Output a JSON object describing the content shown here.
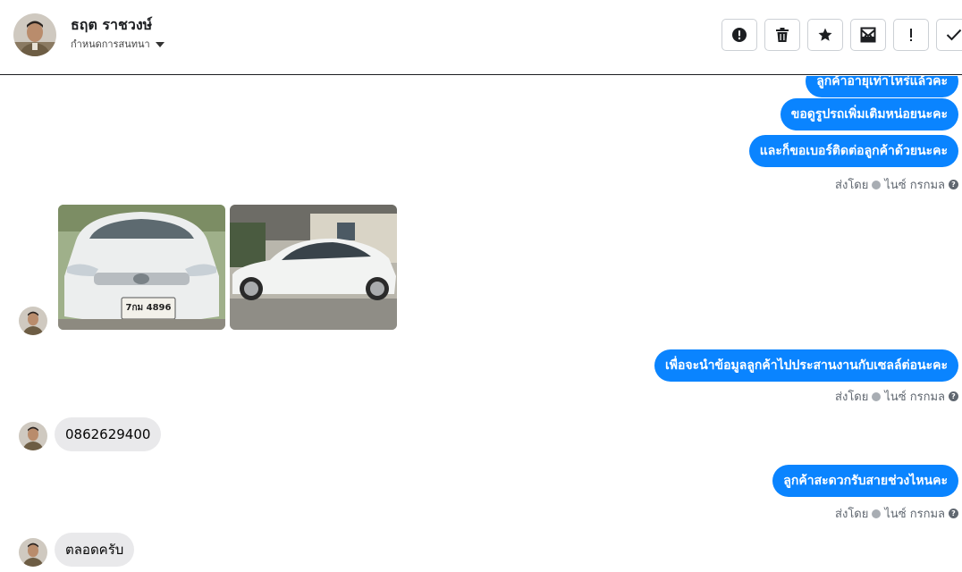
{
  "header": {
    "name": "ธฤต ราชวงษ์",
    "subtitle": "กำหนดการสนทนา"
  },
  "toolbar": {
    "buttons": [
      {
        "name": "report-icon"
      },
      {
        "name": "trash-icon"
      },
      {
        "name": "star-icon"
      },
      {
        "name": "mail-icon"
      },
      {
        "name": "important-icon"
      },
      {
        "name": "check-icon"
      }
    ]
  },
  "messages": {
    "out_partial": "ลูกค้าอายุเท่าไหร่แล้วคะ",
    "out_1": "ขอดูรูปรถเพิ่มเติมหน่อยนะคะ",
    "out_2": "และก็ขอเบอร์ติดต่อลูกค้าด้วยนะคะ",
    "sent_by_1": "ส่งโดย",
    "sender_1": "ไนซ์ กรกมล",
    "photo_plate": "7กม 4896",
    "out_3": "เพื่อจะนำข้อมูลลูกค้าไปประสานงานกับเซลล์ต่อนะคะ",
    "sent_by_2": "ส่งโดย",
    "sender_2": "ไนซ์ กรกมล",
    "in_1": "0862629400",
    "out_4": "ลูกค้าสะดวกรับสายช่วงไหนคะ",
    "sent_by_3": "ส่งโดย",
    "sender_3": "ไนซ์ กรกมล",
    "in_2": "ตลอดครับ"
  },
  "colors": {
    "outgoing": "#0a84ff",
    "incoming": "#e9e9eb"
  }
}
